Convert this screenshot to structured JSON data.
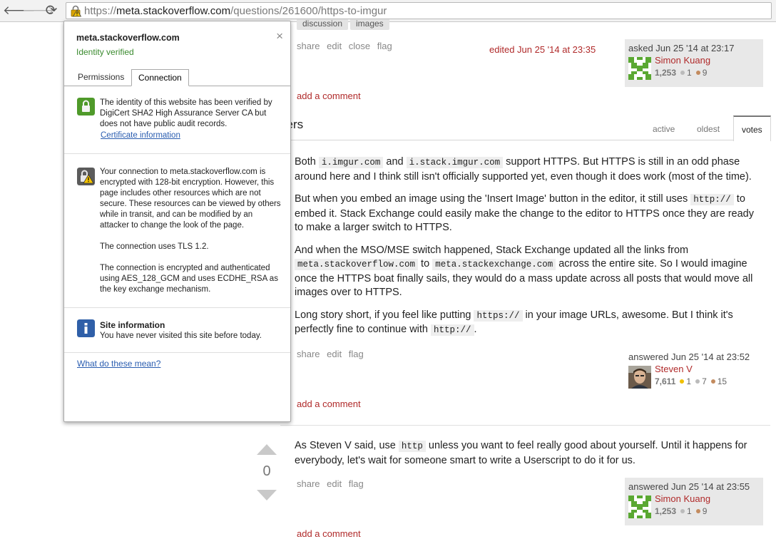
{
  "browser": {
    "url_scheme": "https://",
    "url_host": "meta.stackoverflow.com",
    "url_path": "/questions/261600/https-to-imgur",
    "back_glyph": "🡐",
    "forward_glyph": "🡒",
    "reload_glyph": "⟳"
  },
  "question": {
    "tags": [
      "discussion",
      "images"
    ],
    "menu": [
      "share",
      "edit",
      "close",
      "flag"
    ],
    "edited": "edited Jun 25 '14 at 23:35",
    "owner": {
      "action": "asked Jun 25 '14 at 23:17",
      "name": "Simon Kuang",
      "rep": "1,253",
      "silver": "1",
      "bronze": "9"
    },
    "add_comment": "add a comment"
  },
  "answers_header": {
    "title": "vers",
    "tabs": [
      "active",
      "oldest",
      "votes"
    ],
    "active_tab": "votes"
  },
  "answer1": {
    "p1": [
      "Both ",
      "i.imgur.com",
      " and ",
      "i.stack.imgur.com",
      " support HTTPS. But HTTPS is still in an odd phase around here and I think still isn't officially supported yet, even though it does work (most of the time)."
    ],
    "p2": [
      "But when you embed an image using the 'Insert Image' button in the editor, it still uses ",
      "http://",
      " to embed it. Stack Exchange could easily make the change to the editor to HTTPS once they are ready to make a larger switch to HTTPS."
    ],
    "p3": [
      "And when the MSO/MSE switch happened, Stack Exchange updated all the links from ",
      "meta.stackoverflow.com",
      " to ",
      "meta.stackexchange.com",
      " across the entire site. So I would imagine once the HTTPS boat finally sails, they would do a mass update across all posts that would move all images over to HTTPS."
    ],
    "p4": [
      "Long story short, if you feel like putting ",
      "https://",
      " in your image URLs, awesome. But I think it's perfectly fine to continue with ",
      "http://",
      "."
    ],
    "menu": [
      "share",
      "edit",
      "flag"
    ],
    "owner": {
      "action": "answered Jun 25 '14 at 23:52",
      "name": "Steven V",
      "rep": "7,611",
      "gold": "1",
      "silver": "7",
      "bronze": "15"
    },
    "add_comment": "add a comment"
  },
  "answer2": {
    "votes": "0",
    "p1": [
      "As Steven V said, use ",
      "http",
      " unless you want to feel really good about yourself. Until it happens for everybody, let's wait for someone smart to write a Userscript to do it for us."
    ],
    "menu": [
      "share",
      "edit",
      "flag"
    ],
    "owner": {
      "action": "answered Jun 25 '14 at 23:55",
      "name": "Simon Kuang",
      "rep": "1,253",
      "silver": "1",
      "bronze": "9"
    },
    "add_comment": "add a comment"
  },
  "popup": {
    "host": "meta.stackoverflow.com",
    "status": "Identity verified",
    "close_glyph": "×",
    "tabs": [
      "Permissions",
      "Connection"
    ],
    "active_tab": "Connection",
    "identity_text": "The identity of this website has been verified by DigiCert SHA2 High Assurance Server CA but does not have public audit records.",
    "cert_link": "Certificate information",
    "connection_p1": "Your connection to meta.stackoverflow.com is encrypted with 128-bit encryption. However, this page includes other resources which are not secure. These resources can be viewed by others while in transit, and can be modified by an attacker to change the look of the page.",
    "connection_p2": "The connection uses TLS 1.2.",
    "connection_p3": "The connection is encrypted and authenticated using AES_128_GCM and uses ECDHE_RSA as the key exchange mechanism.",
    "site_info_title": "Site information",
    "site_info_text": "You have never visited this site before today.",
    "help_link": "What do these mean?"
  }
}
